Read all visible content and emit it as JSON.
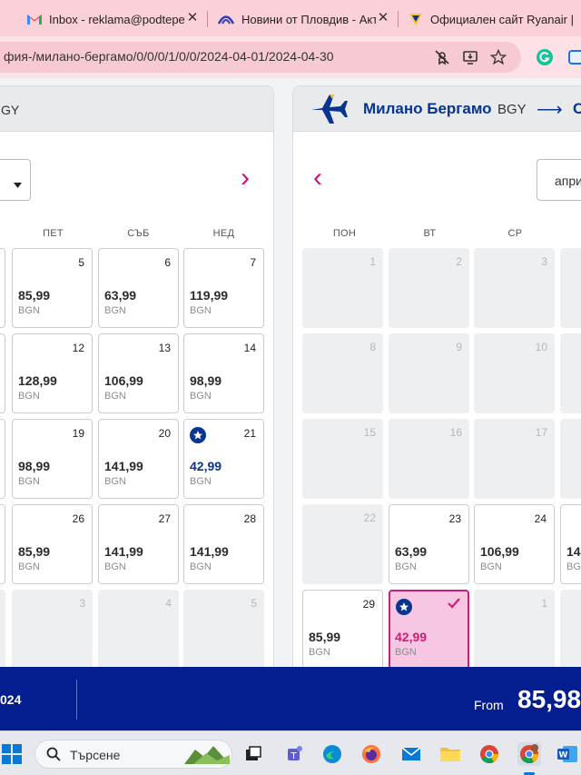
{
  "browser": {
    "tabs": [
      {
        "label": "Inbox - reklama@podtepet",
        "icon": "gmail-icon"
      },
      {
        "label": "Новини от Пловдив - Акт",
        "icon": "news-icon"
      },
      {
        "label": "Официален сайт Ryanair |",
        "icon": "ryanair-icon"
      }
    ],
    "tab_close": "✕",
    "url": "фия-/милано-бергамо/0/0/0/1/0/0/2024-04-01/2024-04-30"
  },
  "left_panel": {
    "header_code": "GY",
    "next_arrow": "›",
    "day_names": [
      "ПЕТ",
      "СЪБ",
      "НЕД"
    ],
    "rows": [
      [
        {
          "day": "5",
          "price": "85,99",
          "currency": "BGN"
        },
        {
          "day": "6",
          "price": "63,99",
          "currency": "BGN"
        },
        {
          "day": "7",
          "price": "119,99",
          "currency": "BGN"
        }
      ],
      [
        {
          "day": "12",
          "price": "128,99",
          "currency": "BGN"
        },
        {
          "day": "13",
          "price": "106,99",
          "currency": "BGN"
        },
        {
          "day": "14",
          "price": "98,99",
          "currency": "BGN"
        }
      ],
      [
        {
          "day": "19",
          "price": "98,99",
          "currency": "BGN"
        },
        {
          "day": "20",
          "price": "141,99",
          "currency": "BGN"
        },
        {
          "day": "21",
          "price": "42,99",
          "currency": "BGN",
          "deal": true
        }
      ],
      [
        {
          "day": "26",
          "price": "85,99",
          "currency": "BGN"
        },
        {
          "day": "27",
          "price": "141,99",
          "currency": "BGN"
        },
        {
          "day": "28",
          "price": "141,99",
          "currency": "BGN"
        }
      ],
      [
        {
          "day": "3",
          "empty": true
        },
        {
          "day": "4",
          "empty": true
        },
        {
          "day": "5",
          "empty": true
        }
      ]
    ]
  },
  "right_panel": {
    "city": "Милано Бергамо",
    "code": "BGY",
    "arrow": "⟶",
    "dest_initial": "С",
    "prev_arrow": "‹",
    "month_select": "април",
    "day_names": [
      "ПОН",
      "ВТ",
      "СР"
    ],
    "rows": [
      [
        {
          "day": "1",
          "empty": true
        },
        {
          "day": "2",
          "empty": true
        },
        {
          "day": "3",
          "empty": true
        }
      ],
      [
        {
          "day": "8",
          "empty": true
        },
        {
          "day": "9",
          "empty": true
        },
        {
          "day": "10",
          "empty": true
        }
      ],
      [
        {
          "day": "15",
          "empty": true
        },
        {
          "day": "16",
          "empty": true
        },
        {
          "day": "17",
          "empty": true
        }
      ],
      [
        {
          "day": "22",
          "empty": true
        },
        {
          "day": "23",
          "price": "63,99",
          "currency": "BGN"
        },
        {
          "day": "24",
          "price": "106,99",
          "currency": "BGN"
        }
      ],
      [
        {
          "day": "29",
          "price": "85,99",
          "currency": "BGN"
        },
        {
          "day": "",
          "price": "42,99",
          "currency": "BGN",
          "deal": true,
          "selected": true
        },
        {
          "day": "1",
          "empty": true
        }
      ]
    ],
    "edge_peek": [
      {
        "price": "14",
        "currency": "BG"
      }
    ]
  },
  "bottom_bar": {
    "date_fragment": "024",
    "from_label": "From",
    "price": "85,98"
  },
  "taskbar": {
    "search_placeholder": "Търсене"
  },
  "colors": {
    "ryanair_blue": "#073590",
    "bottom_bar": "#051e8f",
    "selected_pink": "#d11b7a",
    "selected_bg": "#f7c6e2",
    "tab_bar": "#fbd0d8"
  }
}
